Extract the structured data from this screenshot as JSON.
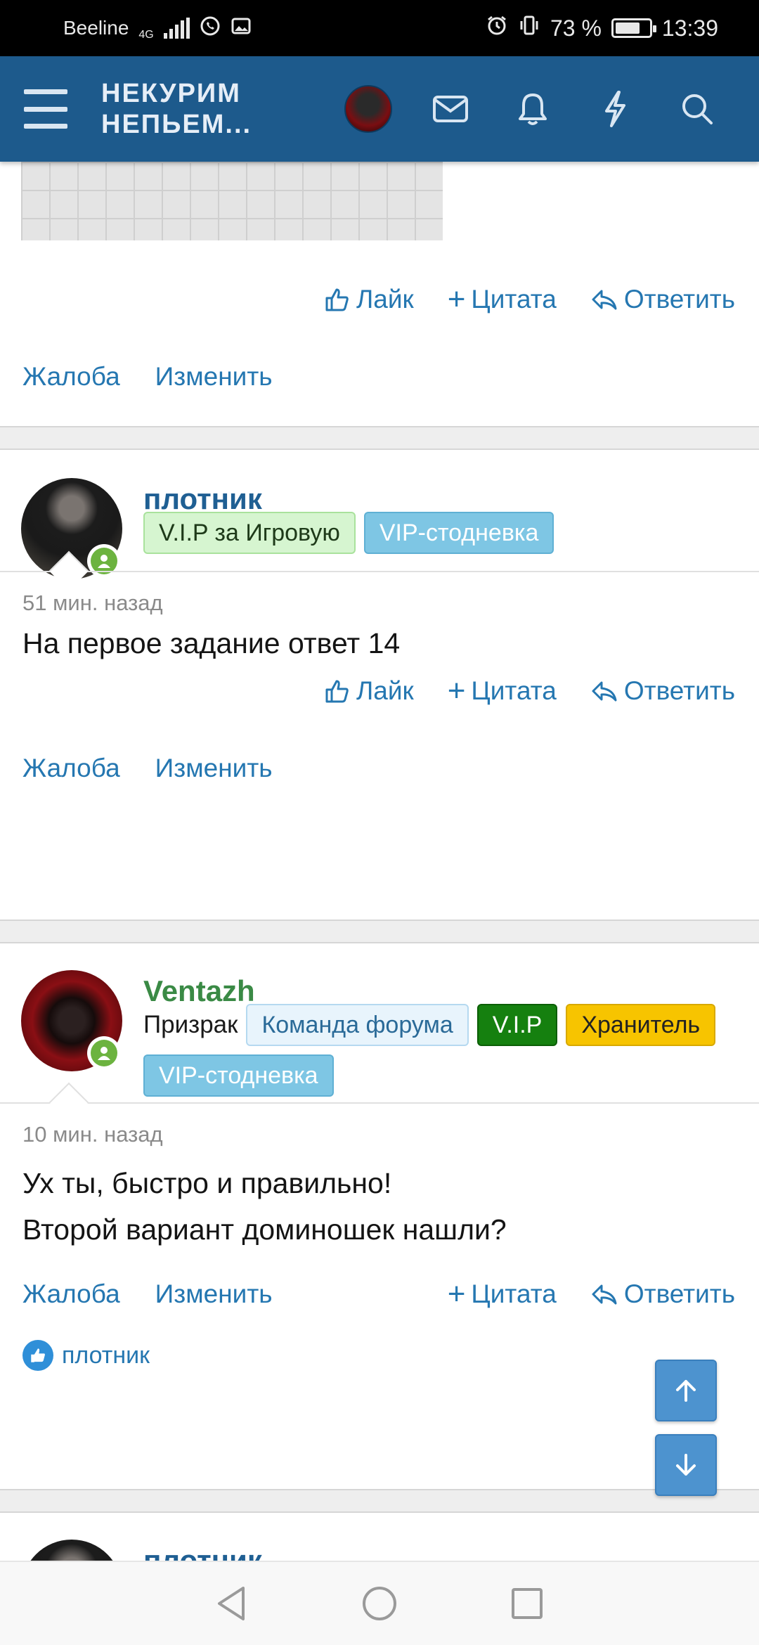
{
  "status_bar": {
    "carrier": "Beeline",
    "network": "4G",
    "battery": "73 %",
    "battery_level": 0.73,
    "time": "13:39"
  },
  "header": {
    "logo_line1": "НЕКУРИМ",
    "logo_line2": "НЕПЬЕМ..."
  },
  "post_actions": {
    "like": "Лайк",
    "quote": "Цитата",
    "reply": "Ответить",
    "report": "Жалоба",
    "edit": "Изменить"
  },
  "posts": [
    {
      "username": "плотник",
      "username_color": "#1f5f93",
      "badges": [
        "V.I.P за Игровую",
        "VIP-стодневка"
      ],
      "time": "51 мин. назад",
      "message": "На первое задание ответ 14"
    },
    {
      "username": "Ventazh",
      "username_color": "#3a8a45",
      "rank": "Призрак",
      "badges": [
        "Команда форума",
        "V.I.P",
        "Хранитель",
        "VIP-стодневка"
      ],
      "time": "10 мин. назад",
      "message_line1": "Ух ты, быстро и правильно!",
      "message_line2": "Второй вариант доминошек нашли?",
      "liked_by": "плотник"
    },
    {
      "username": "плотник"
    }
  ],
  "colors": {
    "header_bg": "#1d5a8c",
    "link": "#2577b1"
  }
}
